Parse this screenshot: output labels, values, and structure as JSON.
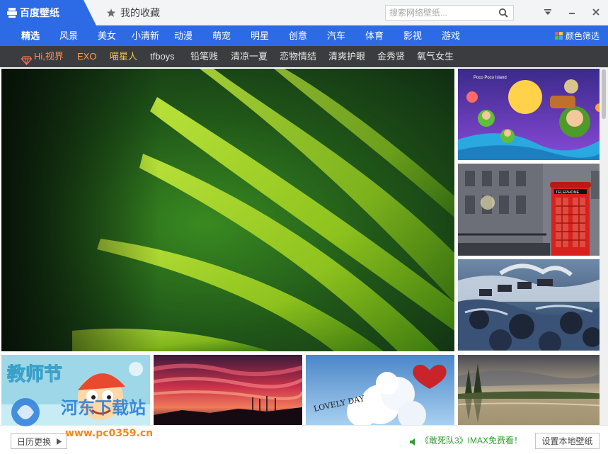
{
  "titlebar": {
    "active_tab": "百度壁纸",
    "favorites_tab": "我的收藏",
    "search_placeholder": "搜索网络壁纸..."
  },
  "nav": {
    "items": [
      {
        "label": "精选",
        "active": true
      },
      {
        "label": "风景"
      },
      {
        "label": "美女"
      },
      {
        "label": "小清新"
      },
      {
        "label": "动漫"
      },
      {
        "label": "萌宠"
      },
      {
        "label": "明星"
      },
      {
        "label": "创意"
      },
      {
        "label": "汽车"
      },
      {
        "label": "体育"
      },
      {
        "label": "影视"
      },
      {
        "label": "游戏"
      }
    ],
    "color_filter": "颜色筛选"
  },
  "tags": {
    "items": [
      "Hi,视界",
      "EXO",
      "喵星人",
      "tfboys",
      "铅笔贱",
      "清凉一夏",
      "恋物情结",
      "清爽护眼",
      "金秀贤",
      "氧气女生"
    ]
  },
  "tiles": {
    "tile1_text": "Poco Poco Island",
    "tile2_text": "TELEPHONE",
    "card1_text": "教师节",
    "card3_text": "LOVELY DAY"
  },
  "bottom": {
    "daily_button": "日历更换",
    "promo_text": "《敢死队3》IMAX免费看！",
    "local_button": "设置本地壁纸"
  },
  "watermark": {
    "logo_text": "河东下载站",
    "url": "www.pc0359.cn"
  },
  "colors": {
    "accent": "#2d6ae6",
    "tagbar_bg": "#3b3c3f",
    "promo_green": "#2e9b2e"
  }
}
